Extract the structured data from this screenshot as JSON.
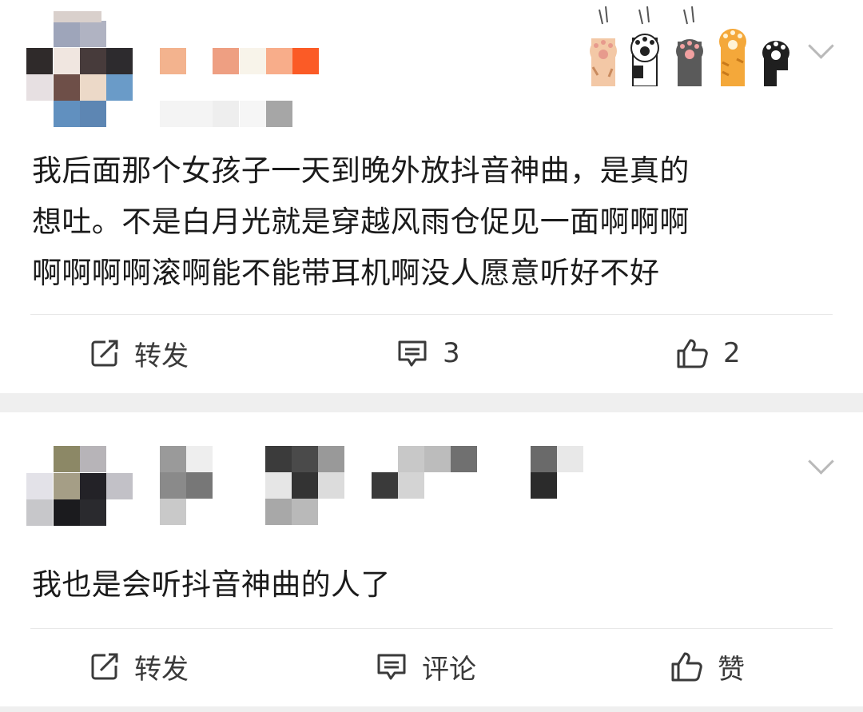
{
  "posts": [
    {
      "content_lines": [
        "我后面那个女孩子一天到晚外放抖音神曲，是真的",
        "想吐。不是白月光就是穿越风雨仓促见一面啊啊啊",
        "啊啊啊啊滚啊能不能带耳机啊没人愿意听好不好"
      ],
      "actions": {
        "repost_label": "转发",
        "comment_count": "3",
        "like_count": "2"
      }
    },
    {
      "content_lines": [
        "我也是会听抖音神曲的人了"
      ],
      "actions": {
        "repost_label": "转发",
        "comment_label": "评论",
        "like_label": "赞"
      }
    }
  ],
  "icons": [
    "repost-icon",
    "comment-icon",
    "like-icon",
    "chevron-down-icon",
    "cat-paw-decoration-icon"
  ],
  "colors": {
    "separator": "#efefef",
    "text": "#1b1b1b",
    "action_text": "#3a3a3a"
  }
}
